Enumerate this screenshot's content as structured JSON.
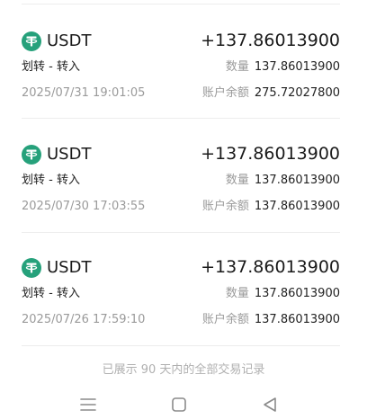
{
  "transactions": [
    {
      "asset": "USDT",
      "amount": "+137.86013900",
      "type": "划转 - 转入",
      "timestamp": "2025/07/31 19:01:05",
      "quantity_label": "数量",
      "quantity": "137.86013900",
      "balance_label": "账户余额",
      "balance": "275.72027800",
      "icon": "tether-icon"
    },
    {
      "asset": "USDT",
      "amount": "+137.86013900",
      "type": "划转 - 转入",
      "timestamp": "2025/07/30 17:03:55",
      "quantity_label": "数量",
      "quantity": "137.86013900",
      "balance_label": "账户余额",
      "balance": "137.86013900",
      "icon": "tether-icon"
    },
    {
      "asset": "USDT",
      "amount": "+137.86013900",
      "type": "划转 - 转入",
      "timestamp": "2025/07/26 17:59:10",
      "quantity_label": "数量",
      "quantity": "137.86013900",
      "balance_label": "账户余额",
      "balance": "137.86013900",
      "icon": "tether-icon"
    }
  ],
  "footer": {
    "note": "已展示 90 天内的全部交易记录"
  },
  "navbar": {
    "menu_icon": "menu-icon",
    "home_icon": "home-square-icon",
    "back_icon": "back-triangle-icon"
  },
  "colors": {
    "tether_green": "#26A17B",
    "text_primary": "#1a1a1a",
    "text_secondary": "#9a9a9a",
    "divider": "#ececec"
  }
}
